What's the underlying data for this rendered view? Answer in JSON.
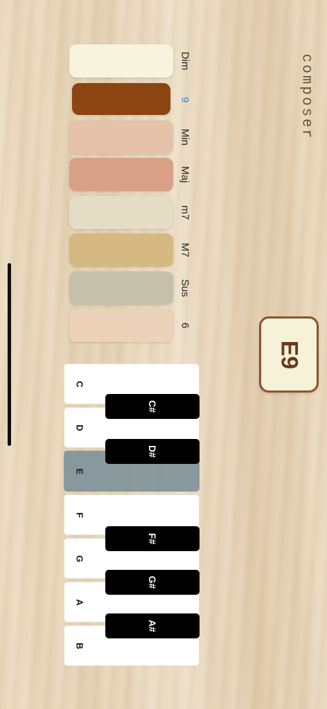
{
  "app": {
    "title": "composer"
  },
  "display": {
    "chord": "E9"
  },
  "chord_qualities": [
    {
      "label": "Dim",
      "color": "#f6f3de",
      "active": false
    },
    {
      "label": "9",
      "color": "#8b4513",
      "active": true
    },
    {
      "label": "Min",
      "color": "#e6c2ab",
      "active": false
    },
    {
      "label": "Maj",
      "color": "#d9a088",
      "active": false
    },
    {
      "label": "m7",
      "color": "#e5dcc6",
      "active": false
    },
    {
      "label": "M7",
      "color": "#d6b883",
      "active": false
    },
    {
      "label": "Sus",
      "color": "#c4c0aa",
      "active": false
    },
    {
      "label": "6",
      "color": "#ecd2b8",
      "active": false
    }
  ],
  "piano": {
    "white_keys": [
      {
        "note": "C",
        "active": false
      },
      {
        "note": "D",
        "active": false
      },
      {
        "note": "E",
        "active": true
      },
      {
        "note": "F",
        "active": false
      },
      {
        "note": "G",
        "active": false
      },
      {
        "note": "A",
        "active": false
      },
      {
        "note": "B",
        "active": false
      }
    ],
    "black_keys": [
      "C#",
      "D#",
      "F#",
      "G#",
      "A#"
    ],
    "active_color": "#84969d"
  }
}
